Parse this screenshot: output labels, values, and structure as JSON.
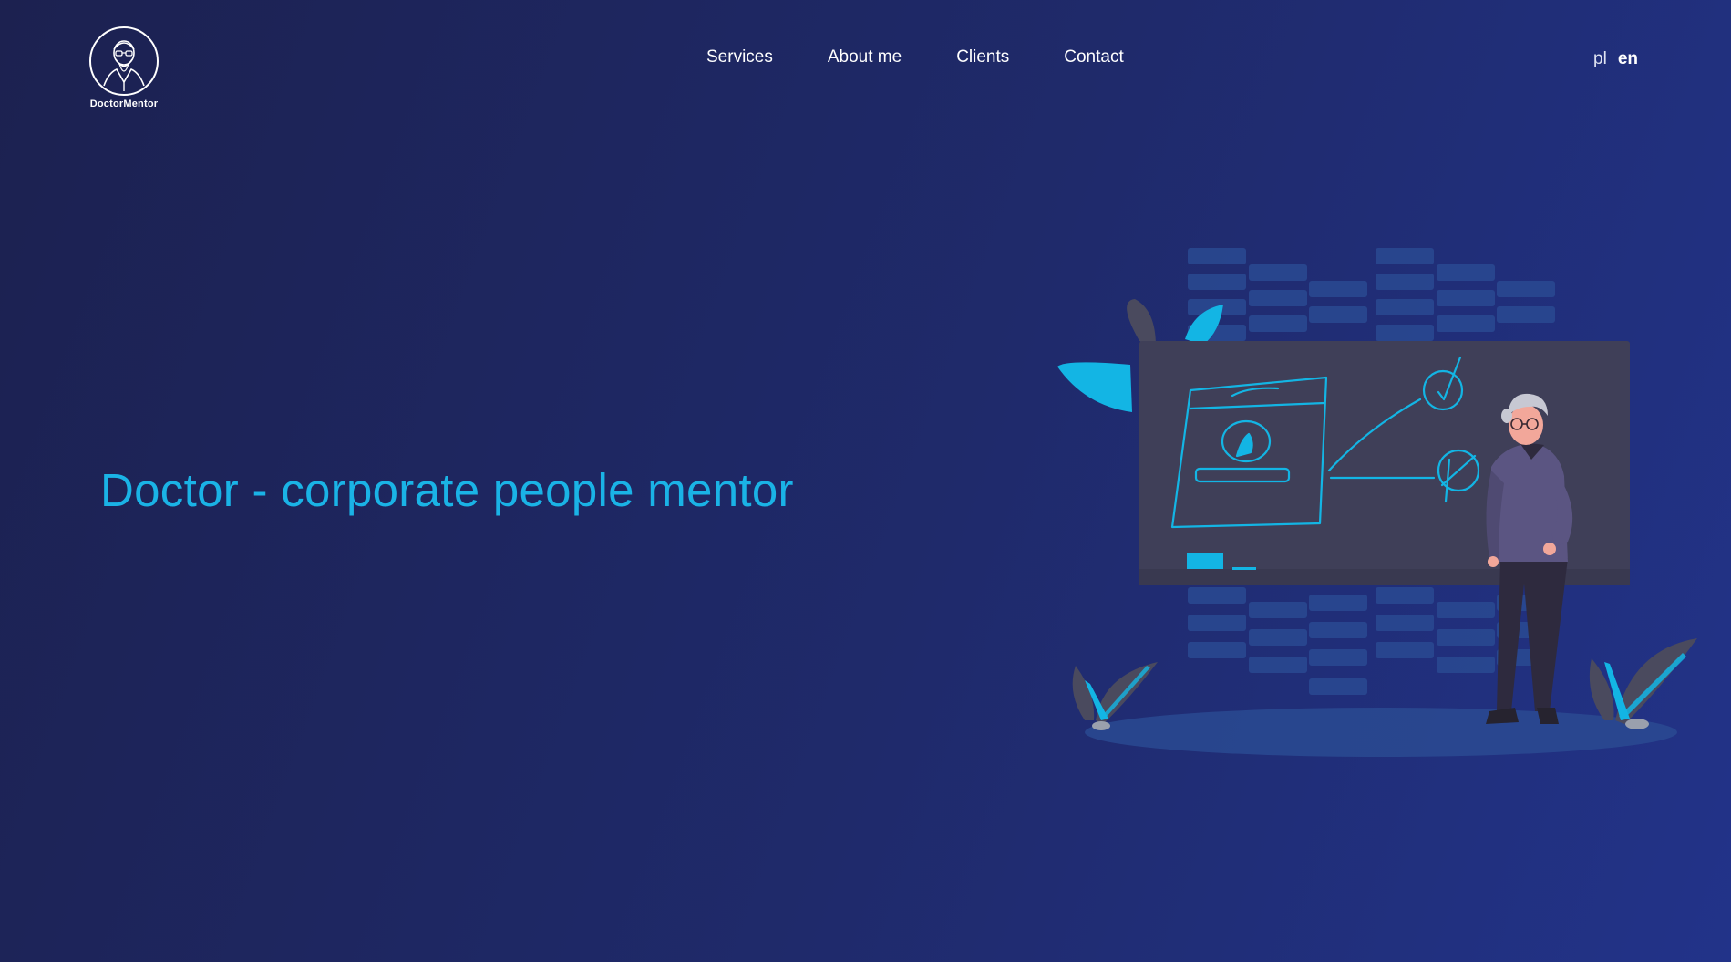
{
  "brand": {
    "logo_text": "DoctorMentor",
    "logo_icon": "doctor-portrait-icon"
  },
  "nav": {
    "items": [
      {
        "label": "Services"
      },
      {
        "label": "About me"
      },
      {
        "label": "Clients"
      },
      {
        "label": "Contact"
      }
    ]
  },
  "language": {
    "options": [
      {
        "label": "pl",
        "active": false
      },
      {
        "label": "en",
        "active": true
      }
    ]
  },
  "hero": {
    "title": "Doctor - corporate people mentor",
    "illustration": "mentor-at-whiteboard-illustration"
  },
  "colors": {
    "background_start": "#1c2150",
    "background_end": "#223389",
    "accent": "#1ab3e6",
    "board": "#3f3f58"
  }
}
